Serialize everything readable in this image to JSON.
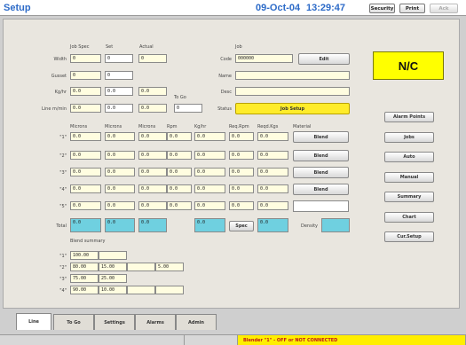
{
  "header": {
    "title": "Setup",
    "date": "09-Oct-04",
    "time": "13:29:47",
    "security_label": "Security",
    "print_label": "Print",
    "ack_label": "Ack"
  },
  "spec": {
    "col_job_spec": "Job Spec",
    "col_set": "Set",
    "col_actual": "Actual",
    "to_go_label": "To Go",
    "rows": [
      {
        "label": "Width",
        "job_spec": "0",
        "set": "0",
        "actual": "0"
      },
      {
        "label": "Gusset",
        "job_spec": "0",
        "set": "0"
      },
      {
        "label": "Kg/hr",
        "job_spec": "0.0",
        "set": "0.0",
        "actual": "0.0"
      },
      {
        "label": "Line m/min",
        "job_spec": "0.0",
        "set": "0.0",
        "actual": "0.0",
        "to_go": "0"
      }
    ]
  },
  "job": {
    "heading": "Job",
    "code_label": "Code",
    "code_value": "000000",
    "edit_label": "Edit",
    "name_label": "Name",
    "name_value": "",
    "desc_label": "Desc",
    "desc_value": "",
    "status_label": "Status",
    "job_setup_label": "Job Setup"
  },
  "nc": "N/C",
  "layers": {
    "headers": {
      "microns1": "Microns",
      "microns2": "Microns",
      "microns3": "Microns",
      "rpm": "Rpm",
      "kghr": "Kg/hr",
      "req_rpm": "Req.Rpm",
      "reqd_kgs": "Reqd.Kgs",
      "material": "Material"
    },
    "rows": [
      {
        "label": "\"1\"",
        "m1": "0.0",
        "m2": "0.0",
        "m3": "0.0",
        "rpm": "0.0",
        "kg": "0.0",
        "req_rpm": "0.0",
        "reqd_kgs": "0.0",
        "blend": "Blend"
      },
      {
        "label": "\"2\"",
        "m1": "0.0",
        "m2": "0.0",
        "m3": "0.0",
        "rpm": "0.0",
        "kg": "0.0",
        "req_rpm": "0.0",
        "reqd_kgs": "0.0",
        "blend": "Blend"
      },
      {
        "label": "\"3\"",
        "m1": "0.0",
        "m2": "0.0",
        "m3": "0.0",
        "rpm": "0.0",
        "kg": "0.0",
        "req_rpm": "0.0",
        "reqd_kgs": "0.0",
        "blend": "Blend"
      },
      {
        "label": "\"4\"",
        "m1": "0.0",
        "m2": "0.0",
        "m3": "0.0",
        "rpm": "0.0",
        "kg": "0.0",
        "req_rpm": "0.0",
        "reqd_kgs": "0.0",
        "blend": "Blend"
      },
      {
        "label": "\"5\"",
        "m1": "0.0",
        "m2": "0.0",
        "m3": "0.0",
        "rpm": "0.0",
        "kg": "0.0",
        "req_rpm": "0.0",
        "reqd_kgs": "0.0"
      }
    ],
    "total": {
      "label": "Total",
      "m1": "0.0",
      "m2": "0.0",
      "m3": "0.0",
      "kg": "0.0",
      "spec_label": "Spec",
      "reqd_kgs": "0.0",
      "density_label": "Density",
      "density_value": ""
    }
  },
  "blend_summary": {
    "title": "Blend summary",
    "rows": [
      {
        "label": "\"1\"",
        "cells": [
          "100.00",
          "",
          "",
          ""
        ]
      },
      {
        "label": "\"2\"",
        "cells": [
          "80.00",
          "15.00",
          "5.00",
          ""
        ]
      },
      {
        "label": "\"3\"",
        "cells": [
          "75.00",
          "25.00",
          "",
          ""
        ]
      },
      {
        "label": "\"4\"",
        "cells": [
          "90.00",
          "10.00",
          "",
          ""
        ]
      }
    ]
  },
  "side_buttons": [
    "Alarm Points",
    "Jobs",
    "Auto",
    "Manual",
    "Summary",
    "Chart",
    "Cur.Setup"
  ],
  "tabs": [
    "Line",
    "To Go",
    "Settings",
    "Alarms",
    "Admin"
  ],
  "statusbar": {
    "message": "Blender \"1\" - OFF or NOT CONNECTED"
  }
}
